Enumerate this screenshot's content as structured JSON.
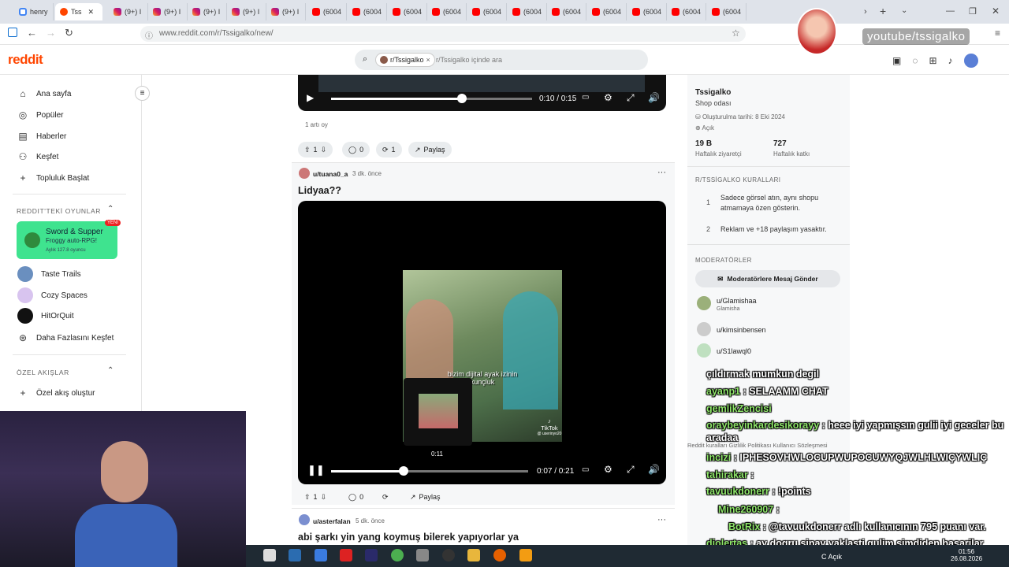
{
  "browser": {
    "tabs": [
      {
        "label": "henry",
        "fav": "g"
      },
      {
        "label": "Tss",
        "fav": "r",
        "active": true
      },
      {
        "label": "(9+) I",
        "fav": "ig"
      },
      {
        "label": "(9+) I",
        "fav": "ig"
      },
      {
        "label": "(9+) I",
        "fav": "ig"
      },
      {
        "label": "(9+) I",
        "fav": "ig"
      },
      {
        "label": "(9+) I",
        "fav": "ig"
      },
      {
        "label": "(6004",
        "fav": "yt"
      },
      {
        "label": "(6004",
        "fav": "yt"
      },
      {
        "label": "(6004",
        "fav": "yt"
      },
      {
        "label": "(6004",
        "fav": "yt"
      },
      {
        "label": "(6004",
        "fav": "yt"
      },
      {
        "label": "(6004",
        "fav": "yt"
      },
      {
        "label": "(6004",
        "fav": "yt"
      },
      {
        "label": "(6004",
        "fav": "yt"
      },
      {
        "label": "(6004",
        "fav": "yt"
      },
      {
        "label": "(6004",
        "fav": "yt"
      },
      {
        "label": "(6004",
        "fav": "yt"
      }
    ],
    "url": "www.reddit.com/r/Tssigalko/new/"
  },
  "header": {
    "logo": "reddit",
    "search_chip": "r/Tssigalko",
    "search_placeholder": "r/Tssigalko içinde ara"
  },
  "sidebar": {
    "nav": [
      "Ana sayfa",
      "Popüler",
      "Haberler",
      "Keşfet",
      "Topluluk Başlat"
    ],
    "games_title": "REDDIT'TEKİ OYUNLAR",
    "featured_game": {
      "name": "Sword & Supper",
      "sub": "Froggy auto-RPG!",
      "meta": "Aylık 127.8 oyuncu",
      "badge": "YENİ"
    },
    "games": [
      "Taste Trails",
      "Cozy Spaces",
      "HitOrQuit",
      "Daha Fazlasını Keşfet"
    ],
    "custom_title": "ÖZEL AKIŞLAR",
    "custom_create": "Özel akış oluştur"
  },
  "post1": {
    "time": "0:10 / 0:15",
    "votes_text": "1 artı oy",
    "votes": "1",
    "comments": "0",
    "shares": "1",
    "share_label": "Paylaş"
  },
  "post2": {
    "author": "u/tuana0_a",
    "time_ago": "3 dk. önce",
    "title": "Lidyaa??",
    "caption": "bizim dijital ayak izinin kunçluk",
    "tiktok": "TikTok",
    "tiktok_user": "@ userinyo20",
    "preview_time": "0:11",
    "time": "0:07 / 0:21",
    "votes": "1",
    "comments": "0",
    "share_label": "Paylaş"
  },
  "post3": {
    "author": "u/asterfalan",
    "time_ago": "5 dk. önce",
    "title": "abi şarkı yin yang koymuş bilerek yapıyorlar ya"
  },
  "community": {
    "name": "Tssigalko",
    "desc": "Shop odası",
    "created": "Oluşturulma tarihi: 8 Eki 2024",
    "open": "Açık",
    "visitors": "19 B",
    "visitors_label": "Haftalık ziyaretçi",
    "contrib": "727",
    "contrib_label": "Haftalık katkı",
    "rules_title": "R/TSSİGALKO KURALLARI",
    "rules": [
      {
        "n": "1",
        "text": "Sadece görsel atın, aynı shopu atmamaya özen gösterin."
      },
      {
        "n": "2",
        "text": "Reklam ve +18 paylaşım yasaktır."
      }
    ],
    "mods_title": "MODERATÖRLER",
    "mod_button": "Moderatörlere Mesaj Gönder",
    "mods": [
      {
        "name": "u/Glamishaa",
        "sub": "Glamisha"
      },
      {
        "name": "u/kimsinbensen",
        "sub": ""
      },
      {
        "name": "u/S1lawql0",
        "sub": ""
      }
    ],
    "footer": "Reddit kuralları   Gizlilik Politikası   Kullanıcı Sözleşmesi"
  },
  "stream": {
    "watermark": "youtube/tssigalko",
    "chat": [
      {
        "user": "",
        "msg": "çıldırmak mumkun degil"
      },
      {
        "user": "ayanp1",
        "msg": ": SELAAMM CHAT"
      },
      {
        "user": "gemlikZencisi",
        "msg": ""
      },
      {
        "user": "oraybeyinkardesikorayy",
        "msg": ": heee iyi yapmışsın gulii iyi geceler bu aradaa"
      },
      {
        "user": "incizi",
        "msg": ": IPHESOVHWLOCUPWUPOCUWYQJWLHLWIÇYWLIÇ"
      },
      {
        "user": "tahirakar",
        "msg": ":"
      },
      {
        "user": "tavuukdonerr",
        "msg": ": !points"
      },
      {
        "user": "Mine260907",
        "msg": ":"
      },
      {
        "user": "BotRix",
        "msg": ": @tavuukdonerr adlı kullanıcının 795 puanı var."
      },
      {
        "user": "diolertas",
        "msg": ": ay dogru sinav yaklasti gulim simdiden basarilar sana dua edicem bol bol"
      }
    ]
  },
  "taskbar": {
    "lang": "C Açık",
    "time": "01:56",
    "date": "26.08.2026"
  }
}
